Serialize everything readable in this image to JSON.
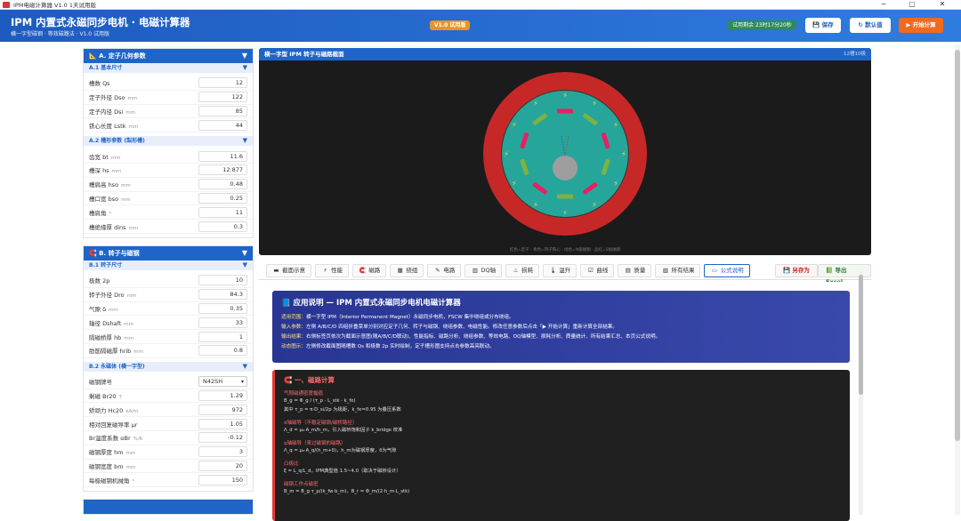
{
  "window": {
    "title": "IPM电磁计算器 V1.0 1天试用版",
    "min": "─",
    "max": "▢",
    "close": "✕"
  },
  "header": {
    "title": "IPM 内置式永磁同步电机 · 电磁计算器",
    "subtitle": "横一字型磁钢 · 等效磁路法 · V1.0 试用版",
    "version_badge": "V1.0 试用版",
    "trial_badge": "试用剩余 23时17分20秒",
    "save_label": "💾 保存",
    "reset_label": "↻ 默认值",
    "calc_label": "▶ 开始计算"
  },
  "panel_a": {
    "title": "📐 A. 定子几何参数",
    "sections": [
      {
        "title": "A.1 基本尺寸",
        "rows": [
          {
            "label": "槽数 Qs",
            "unit": "",
            "value": "12"
          },
          {
            "label": "定子外径 Dso",
            "unit": "mm",
            "value": "122"
          },
          {
            "label": "定子内径 Dsi",
            "unit": "mm",
            "value": "85"
          },
          {
            "label": "铁心长度 Lstk",
            "unit": "mm",
            "value": "44"
          }
        ]
      },
      {
        "title": "A.2 槽形参数 (梨形槽)",
        "rows": [
          {
            "label": "齿宽 bt",
            "unit": "mm",
            "value": "11.6"
          },
          {
            "label": "槽深 hs",
            "unit": "mm",
            "value": "12.877"
          },
          {
            "label": "槽肩高 hso",
            "unit": "mm",
            "value": "0.48"
          },
          {
            "label": "槽口宽 bso",
            "unit": "mm",
            "value": "0.25"
          },
          {
            "label": "槽肩角",
            "unit": "°",
            "value": "11"
          },
          {
            "label": "槽绝缘厚 dins",
            "unit": "mm",
            "value": "0.3"
          }
        ]
      }
    ]
  },
  "panel_b": {
    "title": "🧲 B. 转子与磁钢",
    "sections": [
      {
        "title": "B.1 转子尺寸",
        "rows": [
          {
            "label": "极数 2p",
            "unit": "",
            "value": "10"
          },
          {
            "label": "转子外径 Dro",
            "unit": "mm",
            "value": "84.3"
          },
          {
            "label": "气隙 δ",
            "unit": "mm",
            "value": "0.35"
          },
          {
            "label": "轴径 Dshaft",
            "unit": "mm",
            "value": "33"
          },
          {
            "label": "隔磁桥厚 hb",
            "unit": "mm",
            "value": "1"
          },
          {
            "label": "肋筋隔磁厚 hrib",
            "unit": "mm",
            "value": "0.8"
          }
        ]
      },
      {
        "title": "B.2 永磁体 (横一字型)",
        "rows": [
          {
            "label": "磁钢牌号",
            "unit": "",
            "value": "N42SH",
            "select": true
          },
          {
            "label": "剩磁 Br20",
            "unit": "T",
            "value": "1.29"
          },
          {
            "label": "矫顽力 Hc20",
            "unit": "kA/m",
            "value": "972"
          },
          {
            "label": "相对回复磁导率 μr",
            "unit": "",
            "value": "1.05"
          },
          {
            "label": "Br温度系数 αBr",
            "unit": "%/K",
            "value": "-0.12"
          },
          {
            "label": "磁钢厚度 hm",
            "unit": "mm",
            "value": "3"
          },
          {
            "label": "磁钢宽度 bm",
            "unit": "mm",
            "value": "20"
          },
          {
            "label": "每极磁钢机械角",
            "unit": "°",
            "value": "150"
          }
        ]
      }
    ]
  },
  "visual": {
    "title": "横一字型 IPM 转子与磁路截面",
    "slot_label": "12槽10极",
    "caption": "红色=定子 · 青色=转子铁心 · 绿色=N极磁钢 · 品红=S极磁钢"
  },
  "colors": {
    "stator": "#c62828",
    "rotor": "#26a69a",
    "n_pole": "#7cb342",
    "s_pole": "#e91e63",
    "shaft": "#9e9e9e"
  },
  "tabs": [
    {
      "icon": "▬",
      "label": "截面示意"
    },
    {
      "icon": "⚡",
      "label": "性能"
    },
    {
      "icon": "🧲",
      "label": "磁路"
    },
    {
      "icon": "▦",
      "label": "绕组"
    },
    {
      "icon": "✎",
      "label": "电路"
    },
    {
      "icon": "▥",
      "label": "DQ轴"
    },
    {
      "icon": "♨",
      "label": "损耗"
    },
    {
      "icon": "🌡",
      "label": "温升"
    },
    {
      "icon": "☑",
      "label": "曲线"
    },
    {
      "icon": "▤",
      "label": "质量"
    },
    {
      "icon": "▧",
      "label": "所有结果"
    },
    {
      "icon": "▭",
      "label": "公式说明"
    }
  ],
  "export": {
    "save_as": "💾 另存为",
    "excel": "📗 导出Excel"
  },
  "info": {
    "title": "📘 应用说明 — IPM 内置式永磁同步电机电磁计算器",
    "lines": [
      [
        "适用范围：",
        "横一字型 IPM（Interior Permanent Magnet）永磁同步电机，FSCW 集中绕组或分布绕组。"
      ],
      [
        "输入参数：",
        "左侧 A/B/C/D 四组折叠菜单分别对应定子几何、转子与磁钢、绕组参数、电磁性能。修改任意参数后点击「▶ 开始计算」重新计算全部结果。"
      ],
      [
        "输出结果：",
        "右侧标签页依次为截面示意图(随A/B/C/D联动)、性能指标、磁路分析、绕组参数、等效电路、DQ轴模型、损耗分析、质量统计、所有结果汇总、本页公式说明。"
      ],
      [
        "动态图示：",
        "左侧修改截面图随槽数 Qs 和极数 2p 实时绘制，定子槽形图支持点击参数高亮联动。"
      ]
    ]
  },
  "magnetic": {
    "title": "🧲 一、磁路计算",
    "blocks": [
      {
        "label": "气隙磁通密度幅值",
        "formulas": [
          "B_g = Φ_g / (τ_p · L_stk · k_fe)",
          "其中 τ_p = π·D_si/2p 为极距，k_fe=0.95 为叠压系数"
        ]
      },
      {
        "label": "d轴磁导（不稳定磁钢/磁桥路径）",
        "formulas": [
          "Λ_d = μ₀·A_m/h_m，引入磁桥饱和因子 k_bridge 校准"
        ]
      },
      {
        "label": "q轴磁导（来过磁钢的磁路）",
        "formulas": [
          "Λ_q = μ₀·A_q/(h_m+δ)，h_m为磁钢厚度，δ为气隙"
        ]
      },
      {
        "label": "凸极比",
        "formulas": [
          "ξ = L_q/L_d，IPM典型值 1.5~4.0（取决于磁桥设计）"
        ]
      },
      {
        "label": "磁钢工作点磁密",
        "formulas": [
          "B_m = B_g·τ_p/(k_fw·b_m)，B_r = Φ_m/(2·h_m·L_stk)"
        ]
      }
    ]
  }
}
